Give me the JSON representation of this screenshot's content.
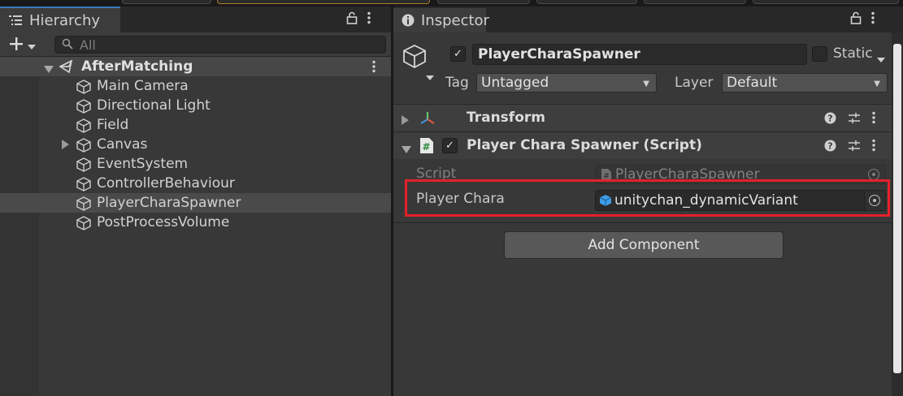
{
  "hierarchy": {
    "tab_label": "Hierarchy",
    "search_placeholder": "All",
    "scene_name": "AfterMatching",
    "items": [
      {
        "label": "Main Camera",
        "has_children": false,
        "selected": false
      },
      {
        "label": "Directional Light",
        "has_children": false,
        "selected": false
      },
      {
        "label": "Field",
        "has_children": false,
        "selected": false
      },
      {
        "label": "Canvas",
        "has_children": true,
        "selected": false
      },
      {
        "label": "EventSystem",
        "has_children": false,
        "selected": false
      },
      {
        "label": "ControllerBehaviour",
        "has_children": false,
        "selected": false
      },
      {
        "label": "PlayerCharaSpawner",
        "has_children": false,
        "selected": true
      },
      {
        "label": "PostProcessVolume",
        "has_children": false,
        "selected": false
      }
    ]
  },
  "inspector": {
    "tab_label": "Inspector",
    "object_name": "PlayerCharaSpawner",
    "active_checked": true,
    "static_label": "Static",
    "static_checked": false,
    "tag_label": "Tag",
    "tag_value": "Untagged",
    "layer_label": "Layer",
    "layer_value": "Default",
    "components": [
      {
        "title": "Transform",
        "expanded": false
      },
      {
        "title": "Player Chara Spawner (Script)",
        "expanded": true,
        "enabled": true
      }
    ],
    "script_label": "Script",
    "script_value": "PlayerCharaSpawner",
    "player_chara_label": "Player Chara",
    "player_chara_value": "unitychan_dynamicVariant",
    "add_component_label": "Add Component"
  },
  "colors": {
    "highlight_box": "#e4202b",
    "tab_accent": "#3a79bb"
  }
}
